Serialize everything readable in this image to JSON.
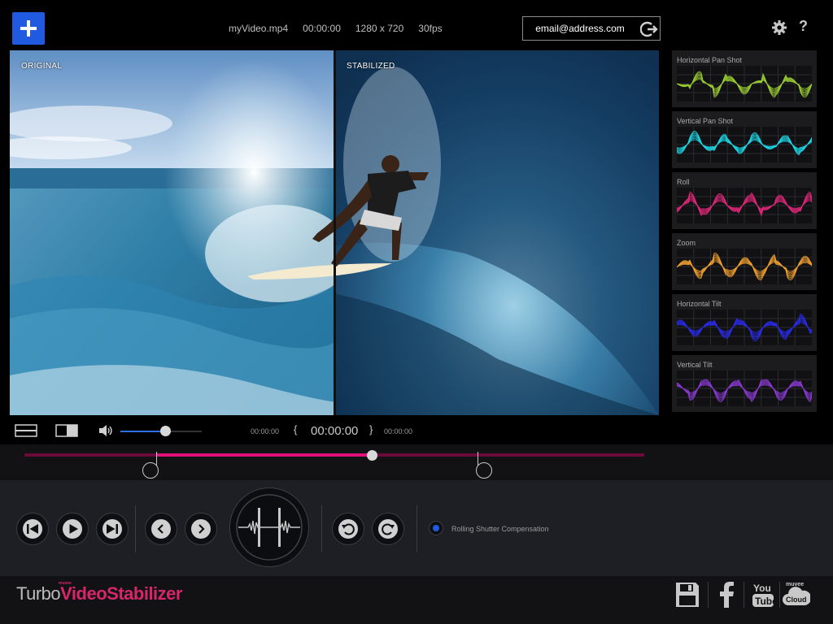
{
  "header": {
    "file_name": "myVideo.mp4",
    "time": "00:00:00",
    "resolution": "1280 x 720",
    "fps": "30fps",
    "email_value": "email@address.com"
  },
  "video": {
    "left_label": "ORIGINAL",
    "right_label": "STABILIZED"
  },
  "graphs": [
    {
      "title": "Horizontal Pan Shot",
      "color": "#9acd32"
    },
    {
      "title": "Vertical Pan Shot",
      "color": "#1ed8e8"
    },
    {
      "title": "Roll",
      "color": "#e0287a"
    },
    {
      "title": "Zoom",
      "color": "#f0a030"
    },
    {
      "title": "Horizontal Tilt",
      "color": "#2a2ae8"
    },
    {
      "title": "Vertical Tilt",
      "color": "#8a3ad0"
    }
  ],
  "playback": {
    "time_left": "00:00:00",
    "time_current": "00:00:00",
    "time_right": "00:00:00",
    "volume_level": 0.55,
    "progress": 0.56
  },
  "controls": {
    "rolling_shutter_label": "Rolling Shutter Compensation"
  },
  "footer": {
    "brand_turbo": "Turbo",
    "brand_stabilizer": "VideoStabilizer",
    "brand_muvee": "muvee",
    "cloud_label_top": "muvee",
    "cloud_label": "Cloud"
  },
  "colors": {
    "accent": "#1f5ae0",
    "timeline": "#e0127a",
    "brand_pink": "#d8266a"
  },
  "icons": [
    "plus-icon",
    "signout-icon",
    "gear-icon",
    "help-icon",
    "single-view-icon",
    "split-view-icon",
    "volume-icon",
    "skip-back-icon",
    "play-icon",
    "skip-forward-icon",
    "prev-frame-icon",
    "next-frame-icon",
    "undo-icon",
    "redo-icon",
    "save-icon",
    "facebook-icon",
    "youtube-icon",
    "cloud-icon"
  ]
}
